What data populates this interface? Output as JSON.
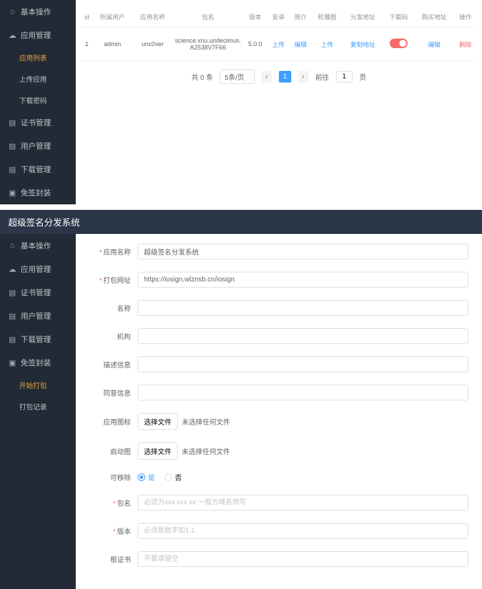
{
  "top": {
    "sidebar": {
      "items": [
        {
          "label": "基本操作",
          "icon": "home"
        },
        {
          "label": "应用管理",
          "icon": "cloud"
        },
        {
          "label": "证书管理",
          "icon": "cert"
        },
        {
          "label": "用户管理",
          "icon": "user"
        },
        {
          "label": "下载管理",
          "icon": "download"
        },
        {
          "label": "免签封装",
          "icon": "package"
        }
      ],
      "subs": [
        {
          "label": "应用列表",
          "active": true
        },
        {
          "label": "上传应用"
        },
        {
          "label": "下载密码"
        }
      ]
    },
    "table": {
      "headers": [
        "id",
        "所属用户",
        "应用名称",
        "包名",
        "版本",
        "安卓",
        "简介",
        "轮播图",
        "分发地址",
        "下载码",
        "购买地址",
        "操作"
      ],
      "row": {
        "id": "1",
        "user": "admin",
        "name": "unc0ver",
        "pkg": "science.xnu.undecimus.A2538V7F66",
        "ver": "5.0.0",
        "android": "上传",
        "intro": "编辑",
        "carousel": "上传",
        "dist": "复制地址",
        "buy": "编辑",
        "op": "删除"
      }
    },
    "pager": {
      "total": "共 0 条",
      "size": "5条/页",
      "page": "1",
      "goto": "前往",
      "gotoval": "1",
      "unit": "页"
    }
  },
  "bottom": {
    "title": "超级签名分发系统",
    "sidebar": {
      "items": [
        {
          "label": "基本操作",
          "icon": "home"
        },
        {
          "label": "应用管理",
          "icon": "cloud"
        },
        {
          "label": "证书管理",
          "icon": "cert"
        },
        {
          "label": "用户管理",
          "icon": "user"
        },
        {
          "label": "下载管理",
          "icon": "download"
        },
        {
          "label": "免签封装",
          "icon": "package"
        }
      ],
      "subs": [
        {
          "label": "开始打包",
          "active": true
        },
        {
          "label": "打包记录"
        }
      ]
    },
    "form": {
      "appname": {
        "label": "应用名称",
        "value": "超级签名分发系统",
        "req": true
      },
      "packurl": {
        "label": "打包网址",
        "value": "https://iosign.wlznsb.cn/iosign",
        "req": true
      },
      "name": {
        "label": "名称",
        "value": ""
      },
      "org": {
        "label": "机构",
        "value": ""
      },
      "desc": {
        "label": "描述信息",
        "value": ""
      },
      "consent": {
        "label": "同意信息",
        "value": ""
      },
      "icon": {
        "label": "应用图标",
        "button": "选择文件",
        "text": "未选择任何文件"
      },
      "launch": {
        "label": "启动图",
        "button": "选择文件",
        "text": "未选择任何文件"
      },
      "removable": {
        "label": "可移除",
        "yes": "是",
        "no": "否"
      },
      "pkgname": {
        "label": "包名",
        "placeholder": "必须为xxx.xxx.xx 一般为域名倒写",
        "req": true
      },
      "version": {
        "label": "版本",
        "placeholder": "必须是数字如1.1",
        "req": true
      },
      "cert": {
        "label": "根证书",
        "placeholder": "不要请留空"
      }
    }
  }
}
